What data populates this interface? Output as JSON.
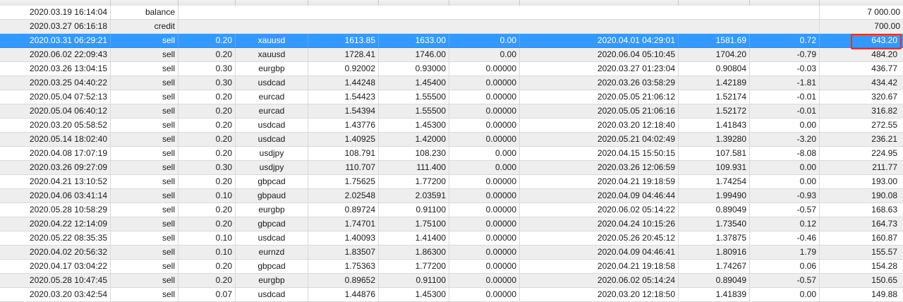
{
  "balance_row": {
    "time": "2020.03.19 16:14:04",
    "type": "balance",
    "profit": "7 000.00"
  },
  "credit_row": {
    "time": "2020.03.27 06:16:18",
    "type": "credit",
    "profit": "700.00"
  },
  "highlight_color": "#e03030",
  "selected_color": "#3399ff",
  "trades": [
    {
      "open_time": "2020.03.31 06:29:21",
      "type": "sell",
      "size": "0.20",
      "item": "xauusd",
      "open_price": "1613.85",
      "sl": "1633.00",
      "tp": "0.00",
      "close_time": "2020.04.01 04:29:01",
      "close_price": "1581.69",
      "swap": "0.72",
      "profit": "643.20",
      "selected": true
    },
    {
      "open_time": "2020.06.02 22:09:43",
      "type": "sell",
      "size": "0.20",
      "item": "xauusd",
      "open_price": "1728.41",
      "sl": "1746.00",
      "tp": "0.00",
      "close_time": "2020.06.04 05:10:45",
      "close_price": "1704.20",
      "swap": "-0.79",
      "profit": "484.20"
    },
    {
      "open_time": "2020.03.26 13:04:15",
      "type": "sell",
      "size": "0.30",
      "item": "eurgbp",
      "open_price": "0.92002",
      "sl": "0.93000",
      "tp": "0.00000",
      "close_time": "2020.03.27 01:23:04",
      "close_price": "0.90804",
      "swap": "-0.03",
      "profit": "436.77"
    },
    {
      "open_time": "2020.03.25 04:40:22",
      "type": "sell",
      "size": "0.30",
      "item": "usdcad",
      "open_price": "1.44248",
      "sl": "1.45400",
      "tp": "0.00000",
      "close_time": "2020.03.26 03:58:29",
      "close_price": "1.42189",
      "swap": "-1.81",
      "profit": "434.42"
    },
    {
      "open_time": "2020.05.04 07:52:13",
      "type": "sell",
      "size": "0.20",
      "item": "eurcad",
      "open_price": "1.54423",
      "sl": "1.55500",
      "tp": "0.00000",
      "close_time": "2020.05.05 21:06:12",
      "close_price": "1.52174",
      "swap": "-0.01",
      "profit": "320.67"
    },
    {
      "open_time": "2020.05.04 06:40:12",
      "type": "sell",
      "size": "0.20",
      "item": "eurcad",
      "open_price": "1.54394",
      "sl": "1.55500",
      "tp": "0.00000",
      "close_time": "2020.05.05 21:06:16",
      "close_price": "1.52172",
      "swap": "-0.01",
      "profit": "316.82"
    },
    {
      "open_time": "2020.03.20 05:58:52",
      "type": "sell",
      "size": "0.20",
      "item": "usdcad",
      "open_price": "1.43776",
      "sl": "1.45300",
      "tp": "0.00000",
      "close_time": "2020.03.20 12:18:40",
      "close_price": "1.41843",
      "swap": "0.00",
      "profit": "272.55"
    },
    {
      "open_time": "2020.05.14 18:02:40",
      "type": "sell",
      "size": "0.20",
      "item": "usdcad",
      "open_price": "1.40925",
      "sl": "1.42000",
      "tp": "0.00000",
      "close_time": "2020.05.21 04:02:49",
      "close_price": "1.39280",
      "swap": "-3.20",
      "profit": "236.21"
    },
    {
      "open_time": "2020.04.08 17:07:19",
      "type": "sell",
      "size": "0.20",
      "item": "usdjpy",
      "open_price": "108.791",
      "sl": "108.230",
      "tp": "0.000",
      "close_time": "2020.04.15 15:50:15",
      "close_price": "107.581",
      "swap": "-8.08",
      "profit": "224.95"
    },
    {
      "open_time": "2020.03.26 09:27:09",
      "type": "sell",
      "size": "0.30",
      "item": "usdjpy",
      "open_price": "110.707",
      "sl": "111.400",
      "tp": "0.000",
      "close_time": "2020.03.26 12:06:59",
      "close_price": "109.931",
      "swap": "0.00",
      "profit": "211.77"
    },
    {
      "open_time": "2020.04.21 13:10:52",
      "type": "sell",
      "size": "0.20",
      "item": "gbpcad",
      "open_price": "1.75625",
      "sl": "1.77200",
      "tp": "0.00000",
      "close_time": "2020.04.21 19:18:59",
      "close_price": "1.74254",
      "swap": "0.00",
      "profit": "193.00"
    },
    {
      "open_time": "2020.04.06 03:41:14",
      "type": "sell",
      "size": "0.10",
      "item": "gbpaud",
      "open_price": "2.02548",
      "sl": "2.03591",
      "tp": "0.00000",
      "close_time": "2020.04.09 04:46:44",
      "close_price": "1.99490",
      "swap": "-0.93",
      "profit": "190.08"
    },
    {
      "open_time": "2020.05.28 10:58:29",
      "type": "sell",
      "size": "0.20",
      "item": "eurgbp",
      "open_price": "0.89724",
      "sl": "0.91100",
      "tp": "0.00000",
      "close_time": "2020.06.02 05:14:22",
      "close_price": "0.89049",
      "swap": "-0.57",
      "profit": "168.63"
    },
    {
      "open_time": "2020.04.22 12:14:09",
      "type": "sell",
      "size": "0.20",
      "item": "gbpcad",
      "open_price": "1.74701",
      "sl": "1.75100",
      "tp": "0.00000",
      "close_time": "2020.04.24 10:15:26",
      "close_price": "1.73540",
      "swap": "0.12",
      "profit": "164.73"
    },
    {
      "open_time": "2020.05.22 08:35:35",
      "type": "sell",
      "size": "0.10",
      "item": "usdcad",
      "open_price": "1.40093",
      "sl": "1.41400",
      "tp": "0.00000",
      "close_time": "2020.05.26 20:45:12",
      "close_price": "1.37875",
      "swap": "-0.46",
      "profit": "160.87"
    },
    {
      "open_time": "2020.04.02 20:56:32",
      "type": "sell",
      "size": "0.10",
      "item": "eurnzd",
      "open_price": "1.83507",
      "sl": "1.86300",
      "tp": "0.00000",
      "close_time": "2020.04.09 04:46:41",
      "close_price": "1.80916",
      "swap": "1.79",
      "profit": "155.57"
    },
    {
      "open_time": "2020.04.17 03:04:22",
      "type": "sell",
      "size": "0.20",
      "item": "gbpcad",
      "open_price": "1.75363",
      "sl": "1.77200",
      "tp": "0.00000",
      "close_time": "2020.04.21 19:18:58",
      "close_price": "1.74267",
      "swap": "0.06",
      "profit": "154.28"
    },
    {
      "open_time": "2020.05.28 10:47:45",
      "type": "sell",
      "size": "0.20",
      "item": "eurgbp",
      "open_price": "0.89652",
      "sl": "0.91100",
      "tp": "0.00000",
      "close_time": "2020.06.02 05:14:24",
      "close_price": "0.89049",
      "swap": "-0.57",
      "profit": "150.65"
    },
    {
      "open_time": "2020.03.20 03:42:54",
      "type": "sell",
      "size": "0.07",
      "item": "usdcad",
      "open_price": "1.44876",
      "sl": "1.45300",
      "tp": "0.00000",
      "close_time": "2020.03.20 12:18:50",
      "close_price": "1.41839",
      "swap": "0.00",
      "profit": "149.88"
    }
  ]
}
